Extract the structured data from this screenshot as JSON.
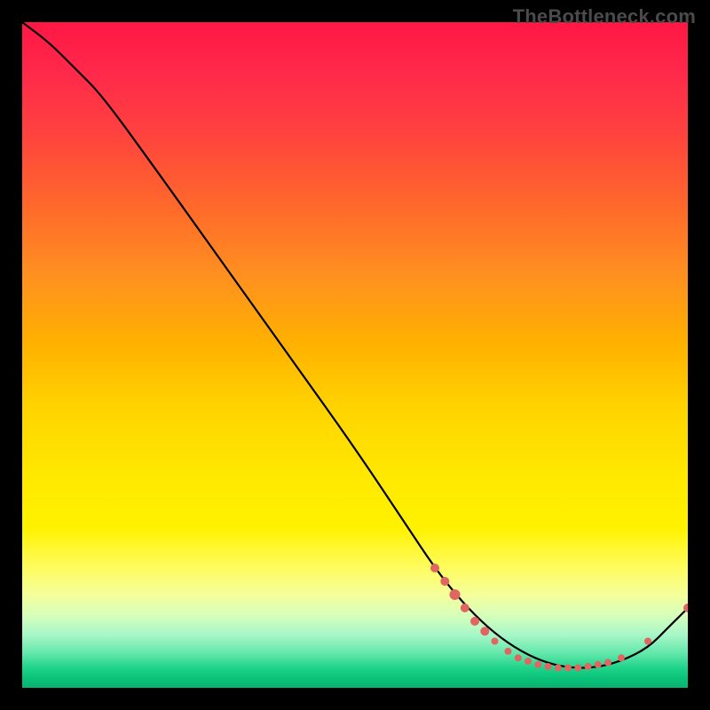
{
  "watermark": "TheBottleneck.com",
  "chart_data": {
    "type": "line",
    "title": "",
    "xlabel": "",
    "ylabel": "",
    "xlim": [
      0,
      100
    ],
    "ylim": [
      0,
      100
    ],
    "grid": false,
    "legend": false,
    "series": [
      {
        "name": "curve",
        "x": [
          0,
          4,
          8,
          12,
          20,
          30,
          40,
          50,
          58,
          62,
          66,
          70,
          74,
          78,
          82,
          86,
          90,
          94,
          97,
          100
        ],
        "y": [
          100,
          97,
          93,
          89,
          78,
          64,
          50,
          36,
          24,
          18,
          13,
          9,
          6,
          4,
          3,
          3,
          4,
          6,
          9,
          12
        ]
      }
    ],
    "markers": [
      {
        "x": 62.0,
        "y": 18.0,
        "r": 5
      },
      {
        "x": 63.5,
        "y": 16.0,
        "r": 5
      },
      {
        "x": 65.0,
        "y": 14.0,
        "r": 6
      },
      {
        "x": 66.5,
        "y": 12.0,
        "r": 5
      },
      {
        "x": 68.0,
        "y": 10.0,
        "r": 5
      },
      {
        "x": 69.5,
        "y": 8.5,
        "r": 5
      },
      {
        "x": 71.0,
        "y": 7.0,
        "r": 4
      },
      {
        "x": 73.0,
        "y": 5.5,
        "r": 4
      },
      {
        "x": 74.5,
        "y": 4.5,
        "r": 4
      },
      {
        "x": 76.0,
        "y": 4.0,
        "r": 4
      },
      {
        "x": 77.5,
        "y": 3.5,
        "r": 4
      },
      {
        "x": 79.0,
        "y": 3.2,
        "r": 4
      },
      {
        "x": 80.5,
        "y": 3.0,
        "r": 4
      },
      {
        "x": 82.0,
        "y": 3.0,
        "r": 4
      },
      {
        "x": 83.5,
        "y": 3.0,
        "r": 4
      },
      {
        "x": 85.0,
        "y": 3.2,
        "r": 4
      },
      {
        "x": 86.5,
        "y": 3.5,
        "r": 4
      },
      {
        "x": 88.0,
        "y": 3.8,
        "r": 4
      },
      {
        "x": 90.0,
        "y": 4.5,
        "r": 4
      },
      {
        "x": 94.0,
        "y": 7.0,
        "r": 4
      },
      {
        "x": 100.0,
        "y": 12.0,
        "r": 5
      }
    ],
    "marker_color": "#e06662",
    "line_color": "#000000"
  }
}
